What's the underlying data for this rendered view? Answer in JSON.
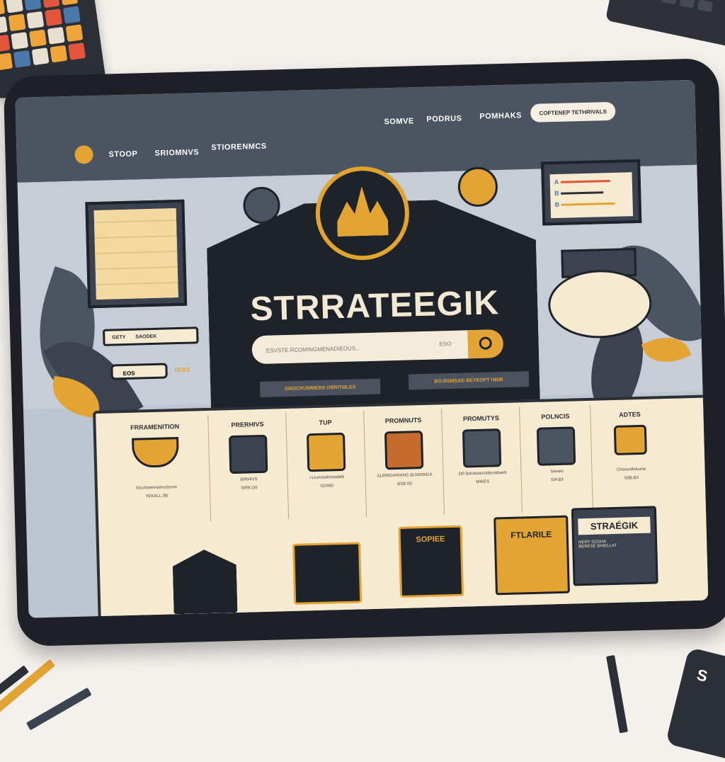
{
  "nav": {
    "links_left": [
      "STOOP",
      "SRIOMNVS",
      "STIORENMCS"
    ],
    "links_right": [
      "SOMVE",
      "PODRUS",
      "POMHAKS"
    ],
    "cta": "COFTENEP TETHRIVALS"
  },
  "hero": {
    "brand": "STRRATEEGIK",
    "search_placeholder": "ESVSTE.RCOMINGMENADIEOUS...",
    "search_hint": "ESO",
    "pill_left": "GROCRUMMERS OBRITMLES",
    "pill_right": "BO.BSMSAD BEYEOPT HBIB"
  },
  "left_widget": {
    "label_a": "GETY",
    "label_b": "SAODEK",
    "input_value": "EOS",
    "badge": "EEB3"
  },
  "right_widget": {
    "rows": [
      "A",
      "B",
      "B"
    ]
  },
  "categories": [
    {
      "title": "FRRAMENITION",
      "sub": "Sourhotemainuctsuns",
      "price": "YEKALL.0B"
    },
    {
      "title": "PRERHIVS",
      "sub": "BIRHIVS",
      "price": "SIRK.D0"
    },
    {
      "title": "TUP",
      "sub": "+LIumstalinvisdelit",
      "price": "SDIMD"
    },
    {
      "title": "PROMNUTS",
      "sub": "CURRDARHING BIJADRICA",
      "price": "BSB.0D"
    },
    {
      "title": "PROMUTYS",
      "sub": "DR Bdulsistunsttoratbanlt",
      "price": "MIKES"
    },
    {
      "title": "POLNCIS",
      "sub": "Seeats",
      "price": "SIP.B3"
    },
    {
      "title": "ADTES",
      "sub": "Chenunilsitume",
      "price": "S0B.B3"
    }
  ],
  "featured": [
    {
      "label": ""
    },
    {
      "label": ""
    },
    {
      "label": "SOPIEE"
    },
    {
      "label": "FTLARILE"
    },
    {
      "label": "STRAÉGIK"
    }
  ],
  "featured_sub": "NERY SOSHA BERESE BHIELLAT",
  "colors": {
    "accent": "#e3a434",
    "dark": "#1e2229",
    "nav": "#4b5461",
    "panel": "#f6ead0"
  }
}
